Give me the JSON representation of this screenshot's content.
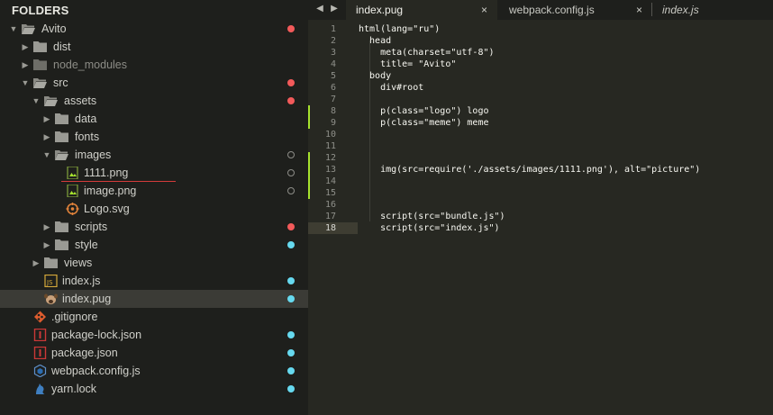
{
  "sidebar": {
    "title": "FOLDERS",
    "items": [
      {
        "name": "Avito",
        "type": "folder-open"
      },
      {
        "name": "dist",
        "type": "folder"
      },
      {
        "name": "node_modules",
        "type": "folder"
      },
      {
        "name": "src",
        "type": "folder-open"
      },
      {
        "name": "assets",
        "type": "folder-open"
      },
      {
        "name": "data",
        "type": "folder"
      },
      {
        "name": "fonts",
        "type": "folder"
      },
      {
        "name": "images",
        "type": "folder-open"
      },
      {
        "name": "1111.png",
        "type": "image-file"
      },
      {
        "name": "image.png",
        "type": "image-file"
      },
      {
        "name": "Logo.svg",
        "type": "svg-file"
      },
      {
        "name": "scripts",
        "type": "folder"
      },
      {
        "name": "style",
        "type": "folder"
      },
      {
        "name": "views",
        "type": "folder"
      },
      {
        "name": "index.js",
        "type": "js-file"
      },
      {
        "name": "index.pug",
        "type": "pug-file"
      },
      {
        "name": ".gitignore",
        "type": "git-file"
      },
      {
        "name": "package-lock.json",
        "type": "npm-file"
      },
      {
        "name": "package.json",
        "type": "npm-file"
      },
      {
        "name": "webpack.config.js",
        "type": "webpack-file"
      },
      {
        "name": "yarn.lock",
        "type": "yarn-file"
      }
    ],
    "status_colors": {
      "modified": "#f25a5a",
      "untracked": "#66d9ef",
      "ignored": "#8d8d88"
    }
  },
  "tabs": [
    {
      "label": "index.pug",
      "close": "×",
      "active": true
    },
    {
      "label": "webpack.config.js",
      "close": "×",
      "active": false
    },
    {
      "label": "index.js",
      "close": "",
      "active": false
    }
  ],
  "tab_nav": {
    "prev": "◀",
    "next": "▶"
  },
  "editor": {
    "lines": [
      {
        "n": "1",
        "text": "html(lang=\"ru\")"
      },
      {
        "n": "2",
        "text": "  head"
      },
      {
        "n": "3",
        "text": "    meta(charset=\"utf-8\")"
      },
      {
        "n": "4",
        "text": "    title= \"Avito\""
      },
      {
        "n": "5",
        "text": "  body"
      },
      {
        "n": "6",
        "text": "    div#root"
      },
      {
        "n": "7",
        "text": ""
      },
      {
        "n": "8",
        "text": "    p(class=\"logo\") logo"
      },
      {
        "n": "9",
        "text": "    p(class=\"meme\") meme"
      },
      {
        "n": "10",
        "text": ""
      },
      {
        "n": "11",
        "text": ""
      },
      {
        "n": "12",
        "text": ""
      },
      {
        "n": "13",
        "text": "    img(src=require('./assets/images/1111.png'), alt=\"picture\")"
      },
      {
        "n": "14",
        "text": ""
      },
      {
        "n": "15",
        "text": ""
      },
      {
        "n": "16",
        "text": ""
      },
      {
        "n": "17",
        "text": "    script(src=\"bundle.js\")"
      },
      {
        "n": "18",
        "text": "    script(src=\"index.js\")"
      }
    ],
    "current_line": "18",
    "colors": {
      "background": "#272822",
      "text": "#f8f8f2",
      "gutter_modified": "#a6e22e"
    }
  }
}
